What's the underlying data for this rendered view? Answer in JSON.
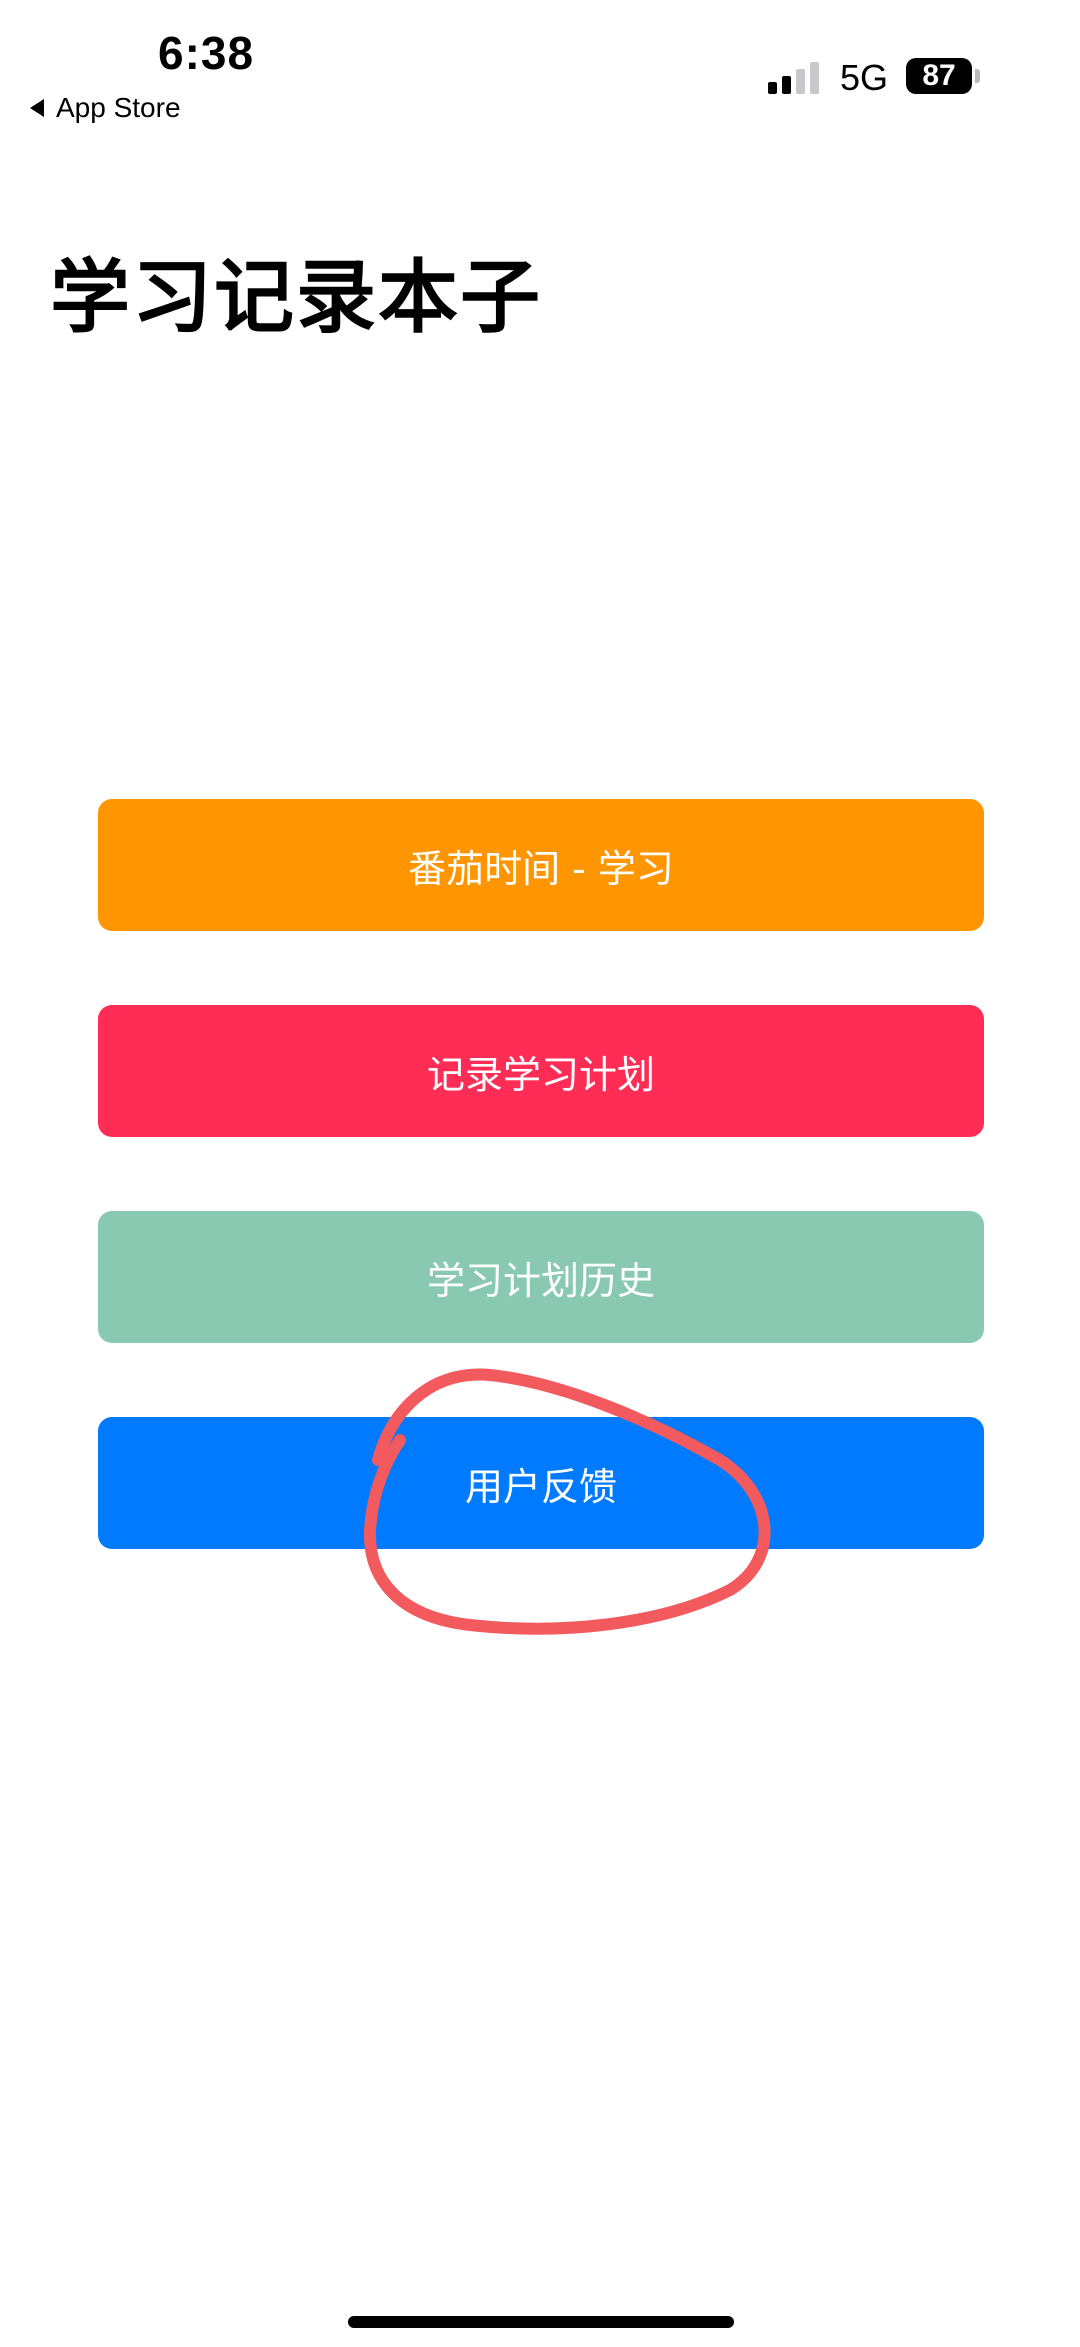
{
  "status_bar": {
    "time": "6:38",
    "back_label": "App Store",
    "network": "5G",
    "battery": "87",
    "signal_bars_active": 2,
    "signal_bars_total": 4
  },
  "page": {
    "title": "学习记录本子"
  },
  "menu": [
    {
      "label": "番茄时间 - 学习",
      "color": "#FF9500"
    },
    {
      "label": "记录学习计划",
      "color": "#FF2D55"
    },
    {
      "label": "学习计划历史",
      "color": "#89C9B2"
    },
    {
      "label": "用户反馈",
      "color": "#007AFF"
    }
  ],
  "annotation": {
    "shape": "hand-drawn-circle",
    "color": "#F25A5E",
    "target": "用户反馈"
  },
  "icons": {
    "back": "back-triangle-icon",
    "signal": "cellular-signal-icon",
    "battery": "battery-icon"
  }
}
